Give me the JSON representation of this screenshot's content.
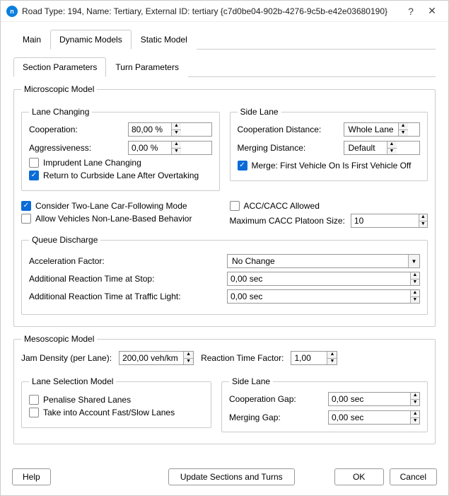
{
  "window": {
    "title": "Road Type: 194, Name: Tertiary, External ID: tertiary  {c7d0be04-902b-4276-9c5b-e42e03680190}",
    "help_icon": "?",
    "close_icon": "✕"
  },
  "tabs": {
    "main": "Main",
    "dynamic": "Dynamic Models",
    "static": "Static Model"
  },
  "subtabs": {
    "section": "Section Parameters",
    "turn": "Turn Parameters"
  },
  "micro": {
    "legend": "Microscopic Model",
    "lane_changing": {
      "legend": "Lane Changing",
      "cooperation_label": "Cooperation:",
      "cooperation_value": "80,00 %",
      "aggr_label": "Aggressiveness:",
      "aggr_value": "0,00 %",
      "imprudent": "Imprudent Lane Changing",
      "rtc": "Return to Curbside Lane After Overtaking"
    },
    "side_lane": {
      "legend": "Side Lane",
      "coop_dist_label": "Cooperation Distance:",
      "coop_dist_value": "Whole Lane",
      "merge_dist_label": "Merging Distance:",
      "merge_dist_value": "Default",
      "merge_fifo": "Merge: First Vehicle On Is First Vehicle Off"
    },
    "consider_two_lane": "Consider Two-Lane Car-Following Mode",
    "allow_non_lane": "Allow Vehicles Non-Lane-Based Behavior",
    "acc_allowed": "ACC/CACC Allowed",
    "max_cacc_label": "Maximum CACC Platoon Size:",
    "max_cacc_value": "10",
    "queue": {
      "legend": "Queue Discharge",
      "accel_label": "Acceleration Factor:",
      "accel_value": "No Change",
      "art_stop_label": "Additional Reaction Time at Stop:",
      "art_stop_value": "0,00 sec",
      "art_tl_label": "Additional Reaction Time at Traffic Light:",
      "art_tl_value": "0,00 sec"
    }
  },
  "meso": {
    "legend": "Mesoscopic Model",
    "jam_label": "Jam Density (per Lane):",
    "jam_value": "200,00 veh/km",
    "rtf_label": "Reaction Time Factor:",
    "rtf_value": "1,00",
    "lane_sel": {
      "legend": "Lane Selection Model",
      "penalise": "Penalise Shared Lanes",
      "fast_slow": "Take into Account Fast/Slow Lanes"
    },
    "side_lane": {
      "legend": "Side Lane",
      "coop_gap_label": "Cooperation Gap:",
      "coop_gap_value": "0,00 sec",
      "merge_gap_label": "Merging Gap:",
      "merge_gap_value": "0,00 sec"
    }
  },
  "footer": {
    "help": "Help",
    "update": "Update Sections and Turns",
    "ok": "OK",
    "cancel": "Cancel"
  }
}
